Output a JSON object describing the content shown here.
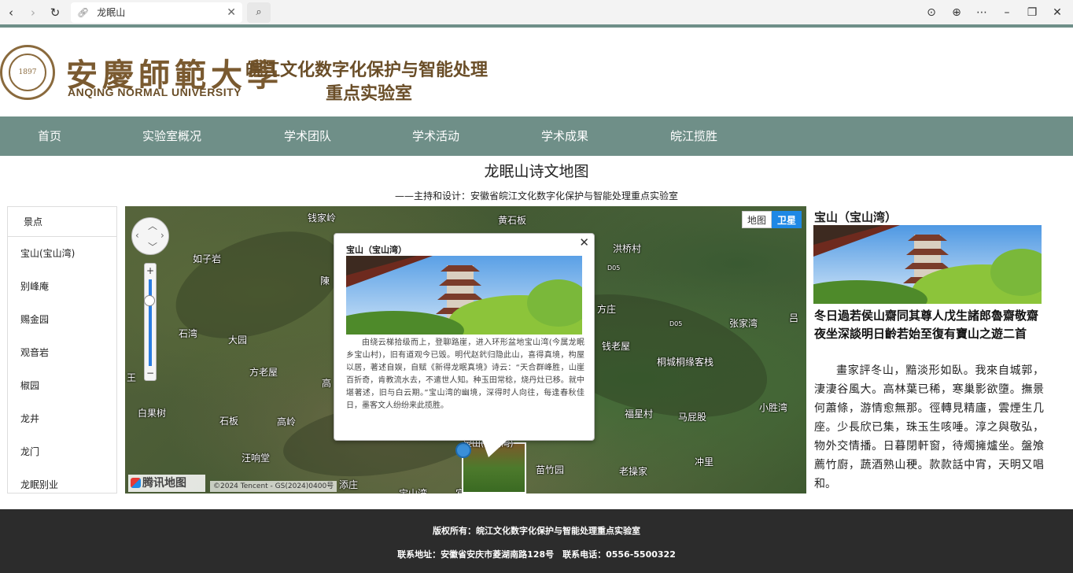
{
  "browser": {
    "tab_title": "龙眠山",
    "back": "‹",
    "forward": "›",
    "reload": "↻",
    "search": "⌕",
    "icons": [
      "download-icon",
      "globe-icon",
      "more-icon",
      "minimize-icon",
      "restore-icon",
      "close-icon"
    ]
  },
  "header": {
    "university_cn": "安慶師範大學",
    "university_en": "ANQING NORMAL UNIVERSITY",
    "seal_year": "1897",
    "lab_line1": "皖江文化数字化保护与智能处理",
    "lab_line2": "重点实验室"
  },
  "nav": [
    "首页",
    "实验室概况",
    "学术团队",
    "学术活动",
    "学术成果",
    "皖江揽胜"
  ],
  "page": {
    "title": "龙眠山诗文地图",
    "subtitle": "——主持和设计：安徽省皖江文化数字化保护与智能处理重点实验室"
  },
  "sidebar": {
    "header": "景点",
    "items": [
      "宝山(宝山湾)",
      "别峰庵",
      "赐金园",
      "观音岩",
      "椒园",
      "龙井",
      "龙门",
      "龙眠别业"
    ]
  },
  "map": {
    "switch": [
      "地图",
      "卫星"
    ],
    "active_type": "卫星",
    "labels": [
      "钱家岭",
      "黄石板",
      "洪桥村",
      "如子岩",
      "陳",
      "方庄",
      "石湾",
      "大园",
      "张家湾",
      "吕",
      "钱老屋",
      "桐城桐缘客栈",
      "方老屋",
      "高",
      "白果树",
      "石板",
      "高岭",
      "福星村",
      "马屁股",
      "小胜湾",
      "汪响堂",
      "苗竹园",
      "老操家",
      "冲里",
      "添庄",
      "宝山湾",
      "王",
      "宝山(宝山湾)",
      "宜",
      "D05",
      "D05"
    ],
    "logo": "腾讯地图",
    "copyright": "©2024 Tencent - GS(2024)0400号",
    "info_window": {
      "title": "宝山（宝山湾）",
      "text": "由绕云梯拾级而上，登聊路崖，进入环形盆地宝山湾(今属龙眠乡宝山村)，旧有道观今已毁。明代赵釴归隐此山，喜得真境，构屋以居，著述自娱，自赋《新得龙眠真境》诗云：“天合群峰胜，山崖百折奇，肯教流水去，不遣世人知。种玉田常稔，烧丹灶已移。就中堪著述，旧与白云期。”宝山湾的幽境，深得时人向往，每逢春秋佳日，墨客文人纷纷来此揽胜。"
    }
  },
  "detail": {
    "title": "宝山（宝山湾）",
    "poem_title": "冬日過若侯山齋同其尊人戊生諸郎魯齋敬齋夜坐深談明日齡若始至復有寶山之遊二首",
    "poem": "畫家評冬山，黯淡形如臥。我來自城郭，淒淒谷風大。高林葉已稀，寒巢影欲墮。撫景何蕭條，游情愈無那。徑轉見精廬，雲煙生几座。少長欣已集，珠玉生咳唾。淳之與敬弘，物外交情播。日暮閉軒窗，待燭擁爐坐。盤飧薦竹廚，蔬酒熟山稉。款款話中宵，天明又唱和。"
  },
  "footer": {
    "copyright": "版权所有：皖江文化数字化保护与智能处理重点实验室",
    "contact": "联系地址：安徽省安庆市菱湖南路128号　联系电话：0556-5500322"
  },
  "colors": {
    "nav_bg": "#6f8f88",
    "brand_brown": "#7a5a30",
    "footer_bg": "#2c2c2c",
    "map_switch_active": "#1e88e5"
  }
}
